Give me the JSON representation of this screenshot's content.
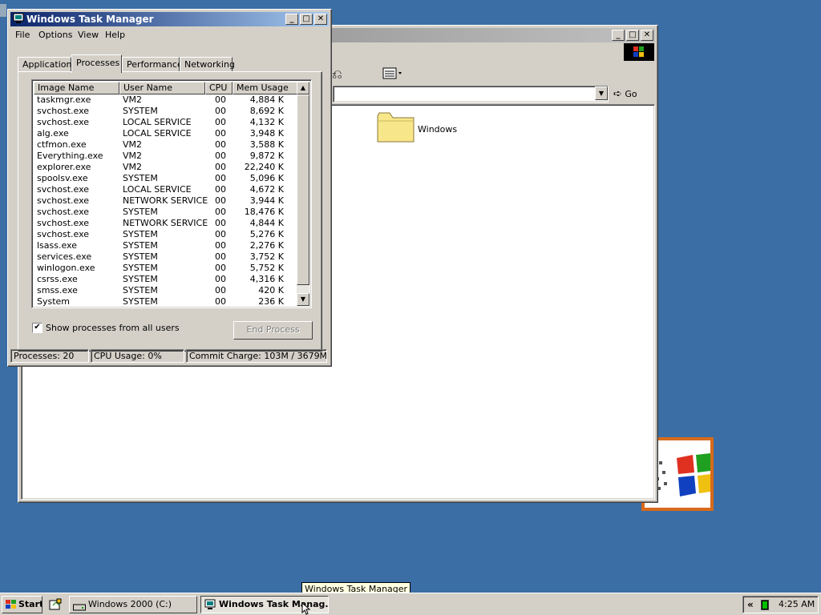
{
  "explorer": {
    "address_value": "",
    "go_label": "Go",
    "folder_label": "Windows"
  },
  "taskmgr": {
    "title": "Windows Task Manager",
    "menu": [
      "File",
      "Options",
      "View",
      "Help"
    ],
    "tabs": [
      "Applications",
      "Processes",
      "Performance",
      "Networking"
    ],
    "active_tab": "Processes",
    "columns": [
      "Image Name",
      "User Name",
      "CPU",
      "Mem Usage"
    ],
    "processes": [
      {
        "name": "taskmgr.exe",
        "user": "VM2",
        "cpu": "00",
        "mem": "4,884 K"
      },
      {
        "name": "svchost.exe",
        "user": "SYSTEM",
        "cpu": "00",
        "mem": "8,692 K"
      },
      {
        "name": "svchost.exe",
        "user": "LOCAL SERVICE",
        "cpu": "00",
        "mem": "4,132 K"
      },
      {
        "name": "alg.exe",
        "user": "LOCAL SERVICE",
        "cpu": "00",
        "mem": "3,948 K"
      },
      {
        "name": "ctfmon.exe",
        "user": "VM2",
        "cpu": "00",
        "mem": "3,588 K"
      },
      {
        "name": "Everything.exe",
        "user": "VM2",
        "cpu": "00",
        "mem": "9,872 K"
      },
      {
        "name": "explorer.exe",
        "user": "VM2",
        "cpu": "00",
        "mem": "22,240 K"
      },
      {
        "name": "spoolsv.exe",
        "user": "SYSTEM",
        "cpu": "00",
        "mem": "5,096 K"
      },
      {
        "name": "svchost.exe",
        "user": "LOCAL SERVICE",
        "cpu": "00",
        "mem": "4,672 K"
      },
      {
        "name": "svchost.exe",
        "user": "NETWORK SERVICE",
        "cpu": "00",
        "mem": "3,944 K"
      },
      {
        "name": "svchost.exe",
        "user": "SYSTEM",
        "cpu": "00",
        "mem": "18,476 K"
      },
      {
        "name": "svchost.exe",
        "user": "NETWORK SERVICE",
        "cpu": "00",
        "mem": "4,844 K"
      },
      {
        "name": "svchost.exe",
        "user": "SYSTEM",
        "cpu": "00",
        "mem": "5,276 K"
      },
      {
        "name": "lsass.exe",
        "user": "SYSTEM",
        "cpu": "00",
        "mem": "2,276 K"
      },
      {
        "name": "services.exe",
        "user": "SYSTEM",
        "cpu": "00",
        "mem": "3,752 K"
      },
      {
        "name": "winlogon.exe",
        "user": "SYSTEM",
        "cpu": "00",
        "mem": "5,752 K"
      },
      {
        "name": "csrss.exe",
        "user": "SYSTEM",
        "cpu": "00",
        "mem": "4,316 K"
      },
      {
        "name": "smss.exe",
        "user": "SYSTEM",
        "cpu": "00",
        "mem": "420 K"
      },
      {
        "name": "System",
        "user": "SYSTEM",
        "cpu": "00",
        "mem": "236 K"
      }
    ],
    "show_all_label": "Show processes from all users",
    "show_all_checked": true,
    "end_process_label": "End Process",
    "status": {
      "processes": "Processes: 20",
      "cpu": "CPU Usage: 0%",
      "commit": "Commit Charge: 103M / 3679M"
    }
  },
  "taskbar": {
    "start_label": "Start",
    "buttons": [
      "Windows 2000 (C:)",
      "Windows Task Manag..."
    ],
    "clock": "4:25 AM",
    "tray_chevron": "«",
    "tooltip": "Windows Task Manager"
  },
  "colors": {
    "desktop": "#3a6ea5",
    "face": "#d4d0c8",
    "active_title": "#0a246a",
    "inactive_title": "#808080"
  }
}
